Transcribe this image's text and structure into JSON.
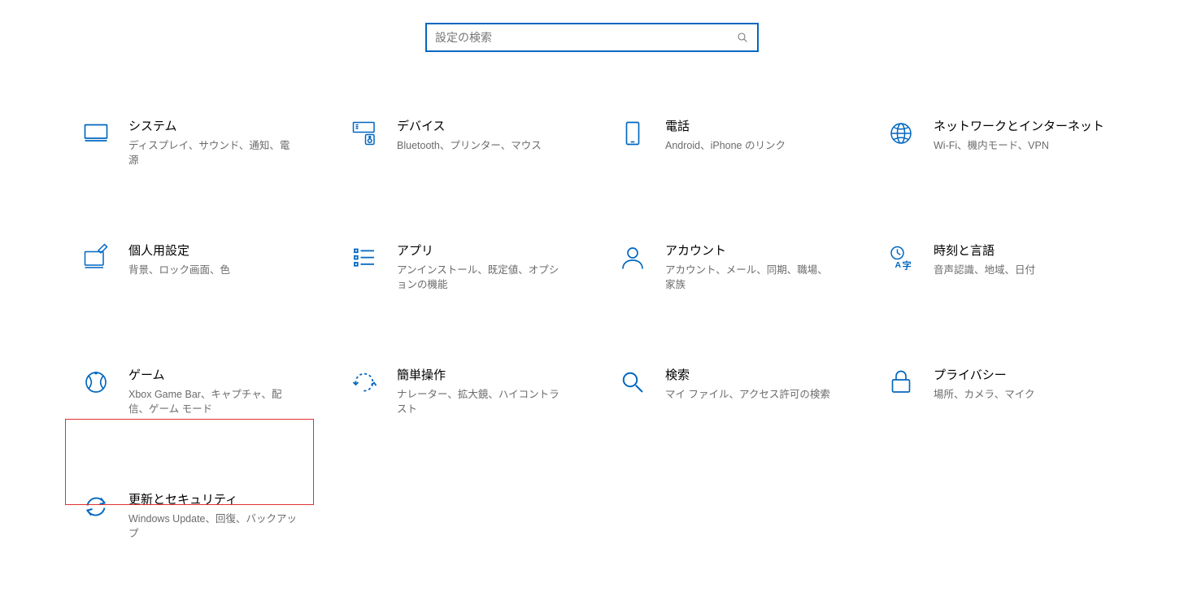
{
  "search": {
    "placeholder": "設定の検索"
  },
  "tiles": {
    "system": {
      "title": "システム",
      "desc": "ディスプレイ、サウンド、通知、電源"
    },
    "devices": {
      "title": "デバイス",
      "desc": "Bluetooth、プリンター、マウス"
    },
    "phone": {
      "title": "電話",
      "desc": "Android、iPhone のリンク"
    },
    "network": {
      "title": "ネットワークとインターネット",
      "desc": "Wi-Fi、機内モード、VPN"
    },
    "personal": {
      "title": "個人用設定",
      "desc": "背景、ロック画面、色"
    },
    "apps": {
      "title": "アプリ",
      "desc": "アンインストール、既定値、オプションの機能"
    },
    "accounts": {
      "title": "アカウント",
      "desc": "アカウント、メール、同期、職場、家族"
    },
    "time": {
      "title": "時刻と言語",
      "desc": "音声認識、地域、日付"
    },
    "gaming": {
      "title": "ゲーム",
      "desc": "Xbox Game Bar、キャプチャ、配信、ゲーム モード"
    },
    "ease": {
      "title": "簡単操作",
      "desc": "ナレーター、拡大鏡、ハイコントラスト"
    },
    "searchc": {
      "title": "検索",
      "desc": "マイ ファイル、アクセス許可の検索"
    },
    "privacy": {
      "title": "プライバシー",
      "desc": "場所、カメラ、マイク"
    },
    "update": {
      "title": "更新とセキュリティ",
      "desc": "Windows Update、回復、バックアップ"
    }
  }
}
